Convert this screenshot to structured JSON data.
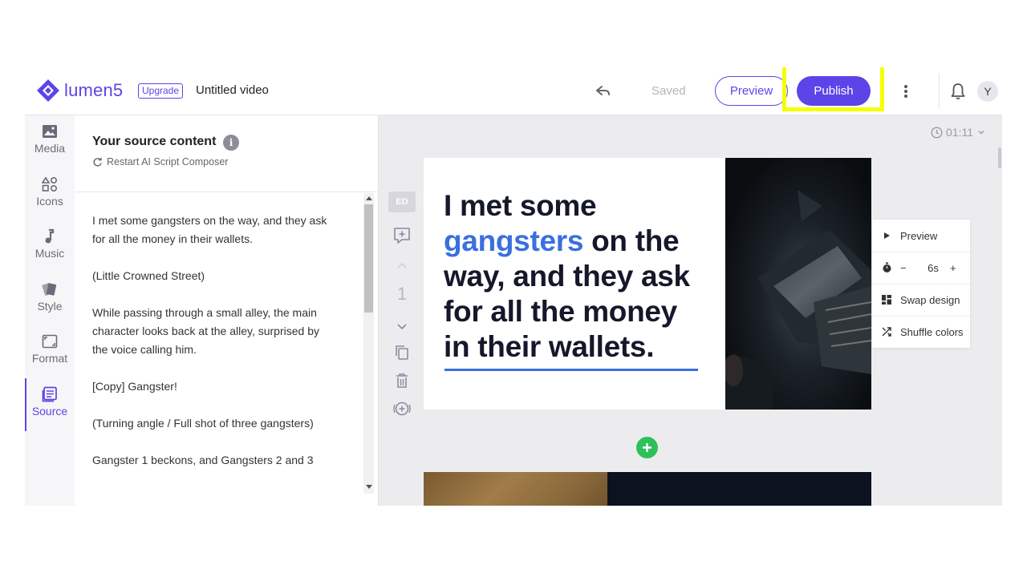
{
  "header": {
    "brand": "lumen5",
    "upgrade_label": "Upgrade",
    "video_title": "Untitled video",
    "save_status": "Saved",
    "preview_label": "Preview",
    "publish_label": "Publish",
    "avatar_initial": "Y"
  },
  "leftnav": {
    "items": [
      {
        "label": "Media",
        "icon": "image-icon"
      },
      {
        "label": "Icons",
        "icon": "shapes-icon"
      },
      {
        "label": "Music",
        "icon": "music-note-icon"
      },
      {
        "label": "Style",
        "icon": "palette-icon"
      },
      {
        "label": "Format",
        "icon": "format-icon"
      },
      {
        "label": "Source",
        "icon": "document-icon"
      }
    ],
    "active": "Source"
  },
  "source": {
    "title": "Your source content",
    "restart_label": "Restart AI Script Composer",
    "paragraphs": [
      "I met some gangsters on the way, and they ask for all the money in their wallets.",
      "(Little Crowned Street)",
      "While passing through a small alley, the main character looks back at the alley, surprised by the voice calling him.",
      "[Copy] Gangster!",
      "(Turning angle / Full shot of three gangsters)",
      "Gangster 1 beckons, and Gangsters 2 and 3"
    ]
  },
  "editor": {
    "duration": "01:11",
    "badge": "ED",
    "scene_number": "1",
    "slide": {
      "line1": "I met some",
      "highlight": "gangsters",
      "line2_rest": " on the",
      "line3": "way, and they ask",
      "line4": "for all the money",
      "line5": "in their wallets."
    },
    "context_menu": {
      "preview": "Preview",
      "duration_minus": "−",
      "duration_value": "6s",
      "duration_plus": "+",
      "swap_design": "Swap design",
      "shuffle_colors": "Shuffle colors"
    }
  },
  "colors": {
    "accent": "#5b45e8",
    "highlight_text": "#3a6fe0",
    "annotation_box": "#f5ff00",
    "add_scene": "#2fbf5b"
  }
}
